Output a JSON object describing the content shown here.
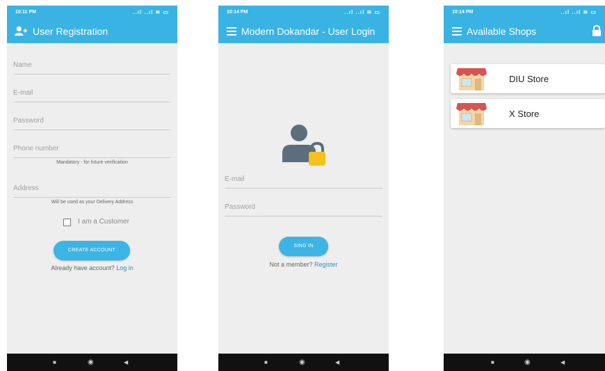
{
  "registration": {
    "status": {
      "time": "10:11 PM",
      "icons": "..ıl ..ıl ≋ ▭"
    },
    "title": "User Registration",
    "fields": {
      "name": "Name",
      "email": "E-mail",
      "password": "Password",
      "phone": "Phone number",
      "address": "Address"
    },
    "phone_hint": "Mandatory - for future verification",
    "address_hint": "Will be used as your Delivery Address",
    "customer_checkbox": "I am a Customer",
    "create_button": "CREATE ACCOUNT",
    "login_prompt": "Already have account?",
    "login_link": "Log in"
  },
  "login": {
    "status": {
      "time": "10:14 PM",
      "icons": "..ıl ..ıl ≋ ▭"
    },
    "title": "Modern Dokandar - User Login",
    "fields": {
      "email": "E-mail",
      "password": "Password"
    },
    "signin_button": "SING IN",
    "register_prompt": "Not a member?",
    "register_link": "Register"
  },
  "shops": {
    "status": {
      "time": "10:14 PM",
      "icons": "..ıl ..ıl ≋ ▭"
    },
    "title": "Available Shops",
    "items": [
      {
        "name": "DIU Store"
      },
      {
        "name": "X Store"
      }
    ]
  },
  "navbar": {
    "square": "■",
    "circle": "◉",
    "back": "◀"
  },
  "colors": {
    "primary": "#39b3e3",
    "link": "#3a87c8",
    "background": "#eeeeee"
  }
}
